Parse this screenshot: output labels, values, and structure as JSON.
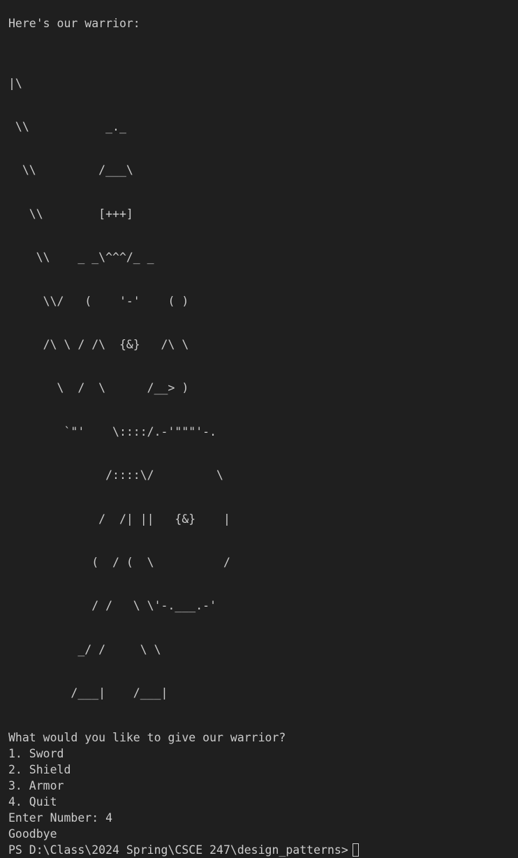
{
  "terminal": {
    "intro": "Here's our warrior:",
    "art_lines": [
      "|\\",
      " \\\\           _._",
      "  \\\\         /___\\",
      "   \\\\        [+++]",
      "    \\\\    _ _\\^^^/_ _",
      "     \\\\/   (    '-'    ( )",
      "     /\\ \\ / /\\  {&}   /\\ \\",
      "       \\  /  \\      /__> )",
      "        `\"'    \\::::/.-'\"\"\"'-.",
      "              /::::\\/         \\",
      "             /  /| ||   {&}    |",
      "            (  / (  \\          /",
      "            / /   \\ \\'-.___.-'",
      "          _/ /     \\ \\",
      "         /___|    /___|"
    ],
    "question": "What would you like to give our warrior?",
    "options": [
      "1. Sword",
      "2. Shield",
      "3. Armor",
      "4. Quit"
    ],
    "enter_number": "Enter Number: 4",
    "goodbye": "Goodbye",
    "prompt": "PS D:\\Class\\2024 Spring\\CSCE 247\\design_patterns>",
    "colors": {
      "background": "#1f1f1f",
      "text": "#cccccc"
    }
  }
}
